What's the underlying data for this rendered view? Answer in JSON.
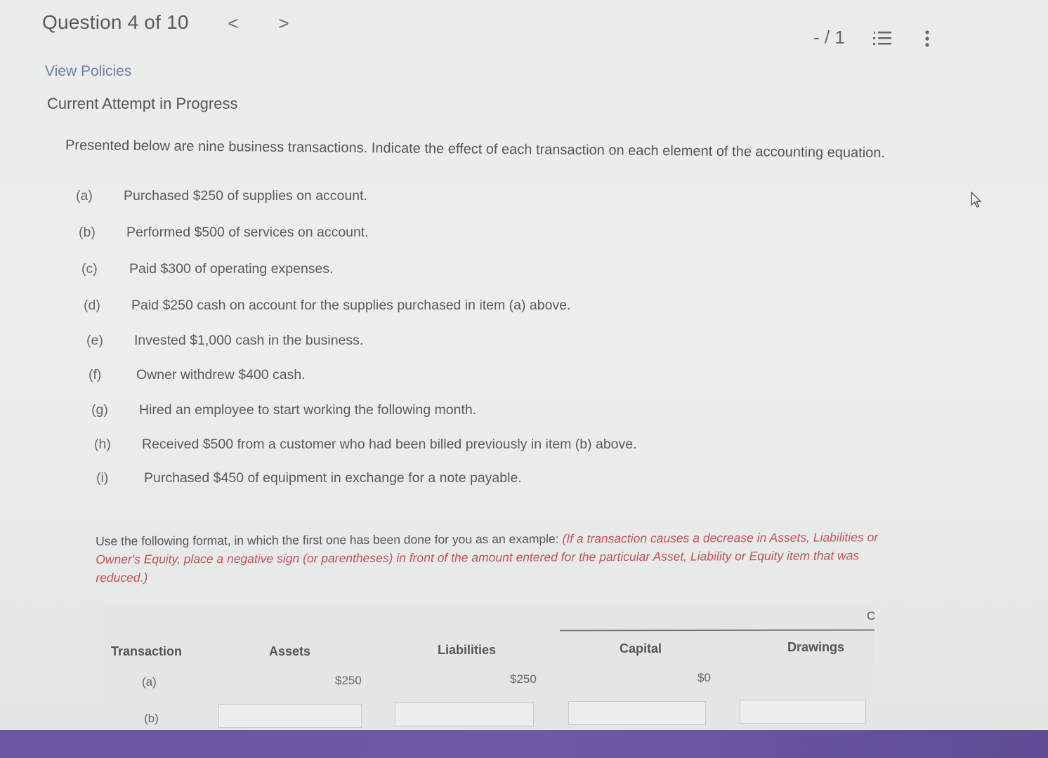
{
  "header": {
    "question_label": "Question 4 of 10",
    "prev_glyph": "<",
    "next_glyph": ">",
    "score": "- / 1"
  },
  "links": {
    "view_policies": "View Policies"
  },
  "status": {
    "attempt": "Current Attempt in Progress"
  },
  "question": {
    "intro": "Presented below are nine business transactions. Indicate the effect of each transaction on each element of the accounting equation.",
    "transactions": [
      {
        "letter": "(a)",
        "text": "Purchased $250 of supplies on account."
      },
      {
        "letter": "(b)",
        "text": "Performed $500 of services on account."
      },
      {
        "letter": "(c)",
        "text": "Paid $300 of operating expenses."
      },
      {
        "letter": "(d)",
        "text": "Paid $250 cash on account for the supplies purchased in item (a) above."
      },
      {
        "letter": "(e)",
        "text": "Invested $1,000 cash in the business."
      },
      {
        "letter": "(f)",
        "text": "Owner withdrew $400 cash."
      },
      {
        "letter": "(g)",
        "text": "Hired an employee to start working the following month."
      },
      {
        "letter": "(h)",
        "text": "Received $500 from a customer who had been billed previously in item (b) above."
      },
      {
        "letter": "(i)",
        "text": "Purchased $450 of equipment in exchange for a note payable."
      }
    ],
    "format_intro": "Use the following format, in which the first one has been done for you as an example: ",
    "format_note": "(If a transaction causes a decrease in Assets, Liabilities or Owner's Equity, place a negative sign (or parentheses) in front of the amount entered for the particular Asset, Liability or Equity item that was reduced.)"
  },
  "table": {
    "group_header": "C",
    "columns": [
      "Transaction",
      "Assets",
      "Liabilities",
      "Capital",
      "Drawings"
    ],
    "rows": [
      {
        "transaction": "(a)",
        "assets": "$250",
        "liabilities": "$250",
        "capital": "$0",
        "drawings": ""
      },
      {
        "transaction": "(b)",
        "assets": "",
        "liabilities": "",
        "capital": "",
        "drawings": ""
      }
    ]
  }
}
